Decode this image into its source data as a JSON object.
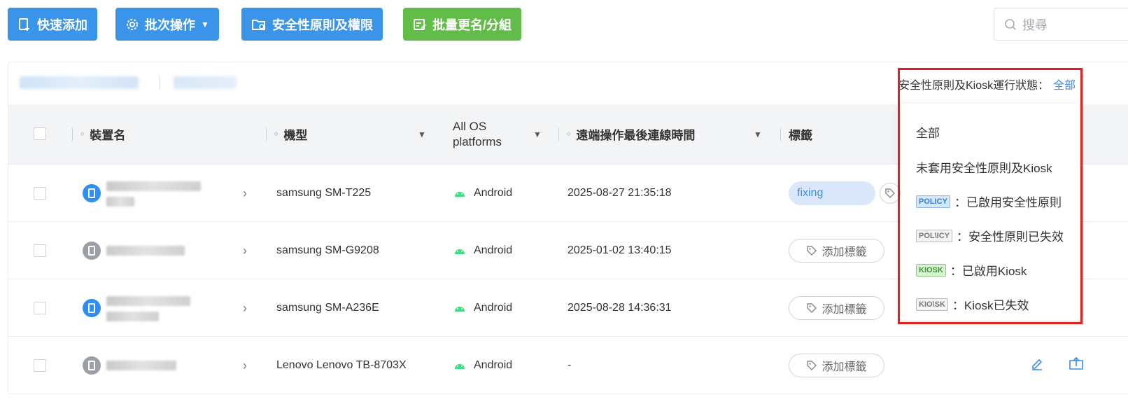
{
  "toolbar": {
    "quick_add": "快速添加",
    "batch_ops": "批次操作",
    "security": "安全性原則及權限",
    "rename_group": "批量更名/分組",
    "search_placeholder": "搜尋"
  },
  "filter": {
    "status_label": "安全性原則及Kiosk運行狀態：",
    "status_value": "全部"
  },
  "columns": {
    "device_name": "裝置名",
    "model": "機型",
    "os_line1": "All OS",
    "os_line2": "platforms",
    "last_connect": "遠端操作最後連線時間",
    "tags": "標籤"
  },
  "rows": [
    {
      "model": "samsung SM-T225",
      "os": "Android",
      "last": "2025-08-27 21:35:18",
      "tag": "fixing",
      "status": "online"
    },
    {
      "model": "samsung SM-G9208",
      "os": "Android",
      "last": "2025-01-02 13:40:15",
      "tag": "添加標籤",
      "status": "offline"
    },
    {
      "model": "samsung SM-A236E",
      "os": "Android",
      "last": "2025-08-28 14:36:31",
      "tag": "添加標籤",
      "status": "online"
    },
    {
      "model": "Lenovo Lenovo TB-8703X",
      "os": "Android",
      "last": "-",
      "tag": "添加標籤",
      "status": "offline"
    }
  ],
  "dropdown": {
    "all": "全部",
    "none": "未套用安全性原則及Kiosk",
    "policy_badge": "POLICY",
    "policy_on": "：已啟用安全性原則",
    "policy_off_badge": "POL\\ICY",
    "policy_off": "：安全性原則已失效",
    "kiosk_badge": "KIOSK",
    "kiosk_on": "：已啟用Kiosk",
    "kiosk_off_badge": "KIO\\SK",
    "kiosk_off": "：Kiosk已失效"
  },
  "colors": {
    "primary": "#3a95ea",
    "success": "#62bd48",
    "highlight_border": "#e02020"
  }
}
